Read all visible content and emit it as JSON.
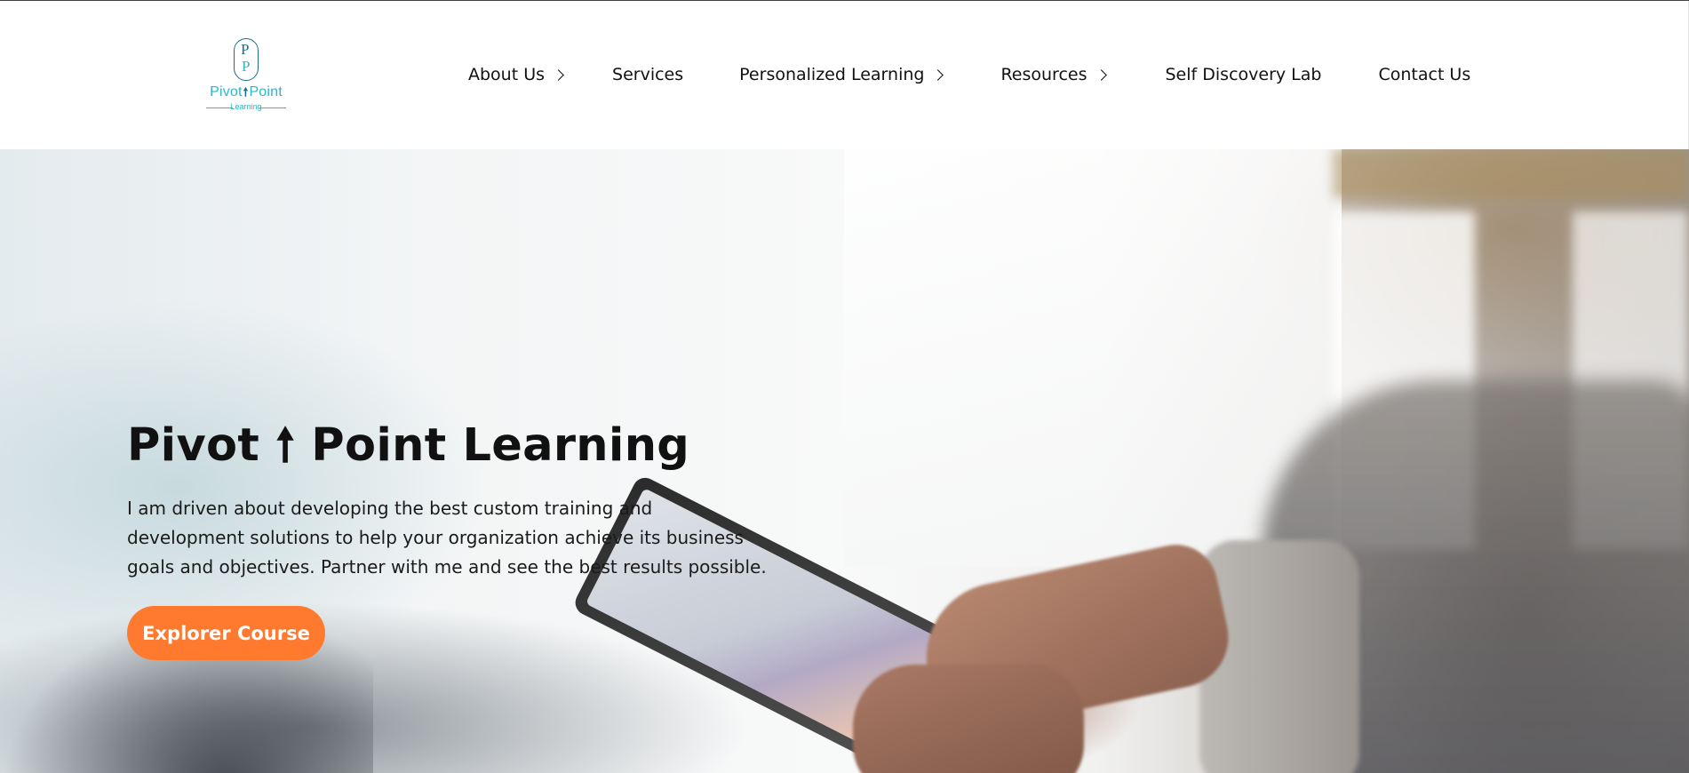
{
  "brand": {
    "logo_initials_top": "P",
    "logo_initials_bottom": "P",
    "logo_word1": "Pivot",
    "logo_arrow": "🠕",
    "logo_word2": "Point",
    "logo_sub": "Learning"
  },
  "nav": {
    "items": [
      {
        "label": "About Us",
        "has_submenu": true
      },
      {
        "label": "Services",
        "has_submenu": false
      },
      {
        "label": "Personalized Learning",
        "has_submenu": true
      },
      {
        "label": "Resources",
        "has_submenu": true
      },
      {
        "label": "Self Discovery Lab",
        "has_submenu": false
      },
      {
        "label": "Contact Us",
        "has_submenu": false
      }
    ]
  },
  "hero": {
    "title": "Pivot 🠕 Point Learning",
    "description": "I am driven about developing the best custom training and development solutions to help your organization achieve its business goals and objectives. Partner with me and see the best results possible.",
    "cta_label": "Explorer Course"
  },
  "colors": {
    "accent": "#ff7a2f",
    "logo_teal": "#2cb8c6",
    "logo_dark_teal": "#1e6f86"
  }
}
